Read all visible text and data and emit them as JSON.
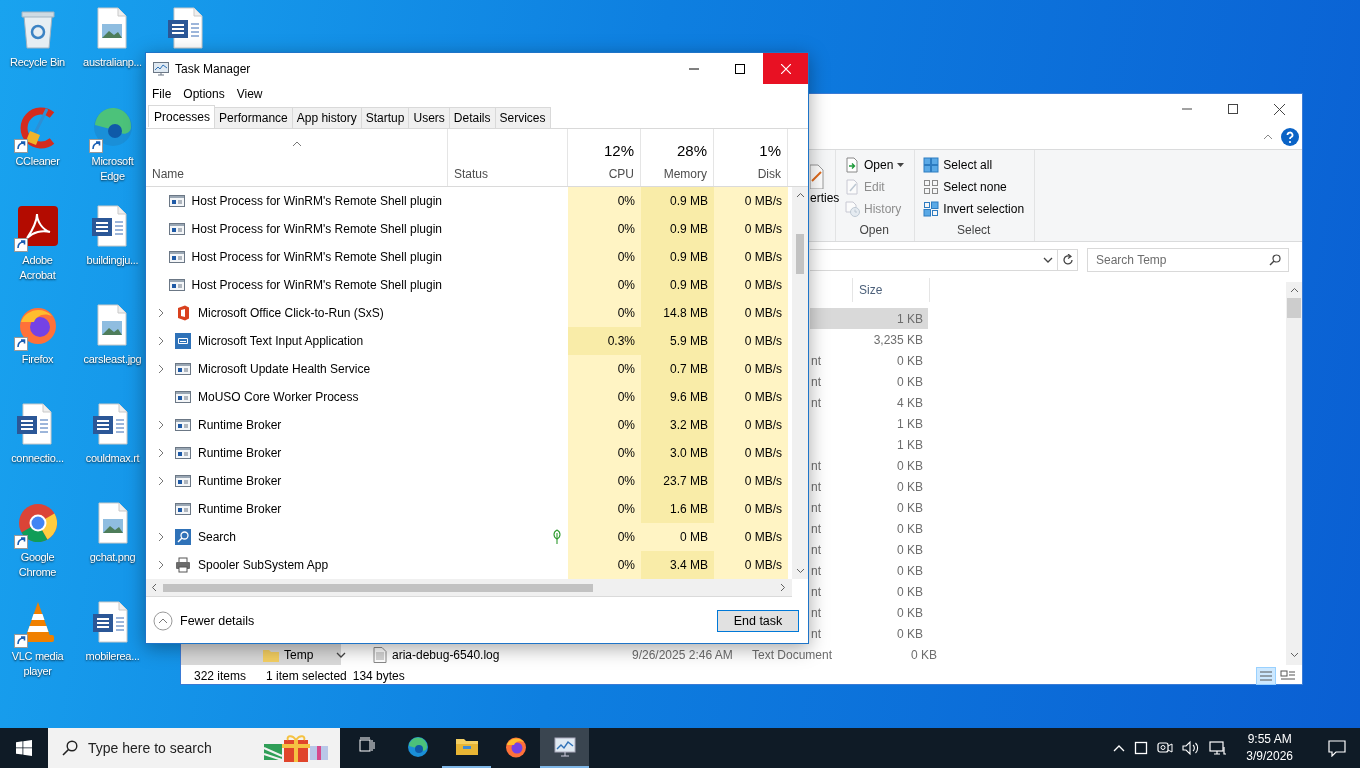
{
  "desktop": {
    "icons": [
      {
        "label": "Recycle Bin",
        "kind": "recycle",
        "shortcut": false
      },
      {
        "label": "CCleaner",
        "kind": "ccleaner",
        "shortcut": true
      },
      {
        "label": "Adobe Acrobat",
        "kind": "acrobat",
        "shortcut": true
      },
      {
        "label": "Firefox",
        "kind": "firefox",
        "shortcut": true
      },
      {
        "label": "connectio...",
        "kind": "word",
        "shortcut": false
      },
      {
        "label": "Google Chrome",
        "kind": "chrome",
        "shortcut": true
      },
      {
        "label": "VLC media player",
        "kind": "vlc",
        "shortcut": true
      },
      {
        "label": "australianp...",
        "kind": "image",
        "shortcut": false
      },
      {
        "label": "Microsoft Edge",
        "kind": "edge",
        "shortcut": true
      },
      {
        "label": "buildingju...",
        "kind": "word",
        "shortcut": false
      },
      {
        "label": "carsleast.jpg",
        "kind": "image",
        "shortcut": false
      },
      {
        "label": "couldmax.rt",
        "kind": "word",
        "shortcut": false
      },
      {
        "label": "gchat.png",
        "kind": "image",
        "shortcut": false
      },
      {
        "label": "mobilerea...",
        "kind": "word",
        "shortcut": false
      },
      {
        "kind": "word",
        "shortcut": false
      }
    ]
  },
  "explorer": {
    "cut_button": "erties",
    "ribbon_groups": [
      {
        "label": "Open",
        "items": [
          {
            "label": "Open",
            "kind": "open",
            "disabled": false,
            "dropdown": true
          },
          {
            "label": "Edit",
            "kind": "edit",
            "disabled": true,
            "dropdown": false
          },
          {
            "label": "History",
            "kind": "history",
            "disabled": true,
            "dropdown": false
          }
        ]
      },
      {
        "label": "Select",
        "items": [
          {
            "label": "Select all",
            "kind": "select-all",
            "disabled": false,
            "dropdown": false
          },
          {
            "label": "Select none",
            "kind": "select-none",
            "disabled": false,
            "dropdown": false
          },
          {
            "label": "Invert selection",
            "kind": "invert",
            "disabled": false,
            "dropdown": false
          }
        ]
      }
    ],
    "search": {
      "placeholder": "Search Temp"
    },
    "size_header": "Size",
    "rows": [
      {
        "size": "1 KB",
        "selected": true
      },
      {
        "size": "3,235 KB",
        "selected": false
      },
      {
        "type": "nt",
        "size": "0 KB",
        "selected": false
      },
      {
        "type": "nt",
        "size": "0 KB",
        "selected": false
      },
      {
        "type": "nt",
        "size": "4 KB",
        "selected": false
      },
      {
        "size": "1 KB",
        "selected": false
      },
      {
        "size": "1 KB",
        "selected": false
      },
      {
        "type": "nt",
        "size": "0 KB",
        "selected": false
      },
      {
        "type": "nt",
        "size": "0 KB",
        "selected": false
      },
      {
        "type": "nt",
        "size": "0 KB",
        "selected": false
      },
      {
        "type": "nt",
        "size": "0 KB",
        "selected": false
      },
      {
        "type": "nt",
        "size": "0 KB",
        "selected": false
      },
      {
        "type": "nt",
        "size": "0 KB",
        "selected": false
      },
      {
        "type": "nt",
        "size": "0 KB",
        "selected": false
      },
      {
        "type": "nt",
        "size": "0 KB",
        "selected": false
      },
      {
        "type": "nt",
        "size": "0 KB",
        "selected": false
      }
    ],
    "nav_item": {
      "label": "Temp",
      "selected": true
    },
    "last_row": {
      "name": "aria-debug-6540.log",
      "date": "9/26/2025 2:46 AM",
      "type": "Text Document",
      "size": "0 KB",
      "selected": false
    },
    "status_bar": [
      "322 items",
      "1 item selected",
      "134 bytes"
    ]
  },
  "task_manager": {
    "title": "Task Manager",
    "menu": [
      "File",
      "Options",
      "View"
    ],
    "tabs": [
      {
        "label": "Processes",
        "selected": true
      },
      {
        "label": "Performance",
        "selected": false
      },
      {
        "label": "App history",
        "selected": false
      },
      {
        "label": "Startup",
        "selected": false
      },
      {
        "label": "Users",
        "selected": false
      },
      {
        "label": "Details",
        "selected": false
      },
      {
        "label": "Services",
        "selected": false
      }
    ],
    "columns": [
      {
        "label": "Name"
      },
      {
        "label": "Status"
      },
      {
        "label": "CPU",
        "total": "12%"
      },
      {
        "label": "Memory",
        "total": "28%"
      },
      {
        "label": "Disk",
        "total": "1%"
      }
    ],
    "processes": [
      {
        "name": "Host Process for WinRM's Remote Shell plugin",
        "kind": "window",
        "expandable": false,
        "efficiency_mode": false,
        "cpu": "0%",
        "memory": "0.9 MB",
        "disk": "0 MB/s",
        "cpu_active": false,
        "mem_active": true
      },
      {
        "name": "Host Process for WinRM's Remote Shell plugin",
        "kind": "window",
        "expandable": false,
        "efficiency_mode": false,
        "cpu": "0%",
        "memory": "0.9 MB",
        "disk": "0 MB/s",
        "cpu_active": false,
        "mem_active": true
      },
      {
        "name": "Host Process for WinRM's Remote Shell plugin",
        "kind": "window",
        "expandable": false,
        "efficiency_mode": false,
        "cpu": "0%",
        "memory": "0.9 MB",
        "disk": "0 MB/s",
        "cpu_active": false,
        "mem_active": true
      },
      {
        "name": "Host Process for WinRM's Remote Shell plugin",
        "kind": "window",
        "expandable": false,
        "efficiency_mode": false,
        "cpu": "0%",
        "memory": "0.9 MB",
        "disk": "0 MB/s",
        "cpu_active": false,
        "mem_active": true
      },
      {
        "name": "Microsoft Office Click-to-Run (SxS)",
        "kind": "office",
        "expandable": true,
        "efficiency_mode": false,
        "cpu": "0%",
        "memory": "14.8 MB",
        "disk": "0 MB/s",
        "cpu_active": false,
        "mem_active": true
      },
      {
        "name": "Microsoft Text Input Application",
        "kind": "keyboard",
        "expandable": true,
        "efficiency_mode": false,
        "cpu": "0.3%",
        "memory": "5.9 MB",
        "disk": "0 MB/s",
        "cpu_active": true,
        "mem_active": true
      },
      {
        "name": "Microsoft Update Health Service",
        "kind": "window",
        "expandable": true,
        "efficiency_mode": false,
        "cpu": "0%",
        "memory": "0.7 MB",
        "disk": "0 MB/s",
        "cpu_active": false,
        "mem_active": true
      },
      {
        "name": "MoUSO Core Worker Process",
        "kind": "window",
        "expandable": false,
        "efficiency_mode": false,
        "cpu": "0%",
        "memory": "9.6 MB",
        "disk": "0 MB/s",
        "cpu_active": false,
        "mem_active": true
      },
      {
        "name": "Runtime Broker",
        "kind": "window",
        "expandable": true,
        "efficiency_mode": false,
        "cpu": "0%",
        "memory": "3.2 MB",
        "disk": "0 MB/s",
        "cpu_active": false,
        "mem_active": true
      },
      {
        "name": "Runtime Broker",
        "kind": "window",
        "expandable": true,
        "efficiency_mode": false,
        "cpu": "0%",
        "memory": "3.0 MB",
        "disk": "0 MB/s",
        "cpu_active": false,
        "mem_active": true
      },
      {
        "name": "Runtime Broker",
        "kind": "window",
        "expandable": true,
        "efficiency_mode": false,
        "cpu": "0%",
        "memory": "23.7 MB",
        "disk": "0 MB/s",
        "cpu_active": false,
        "mem_active": true
      },
      {
        "name": "Runtime Broker",
        "kind": "window",
        "expandable": false,
        "efficiency_mode": false,
        "cpu": "0%",
        "memory": "1.6 MB",
        "disk": "0 MB/s",
        "cpu_active": false,
        "mem_active": true
      },
      {
        "name": "Search",
        "kind": "search",
        "expandable": true,
        "efficiency_mode": true,
        "cpu": "0%",
        "memory": "0 MB",
        "disk": "0 MB/s",
        "cpu_active": false,
        "mem_active": false
      },
      {
        "name": "Spooler SubSystem App",
        "kind": "printer",
        "expandable": true,
        "efficiency_mode": false,
        "cpu": "0%",
        "memory": "3.4 MB",
        "disk": "0 MB/s",
        "cpu_active": false,
        "mem_active": true
      }
    ],
    "details_toggle": "Fewer details",
    "end_button": "End task"
  },
  "taskbar": {
    "search": {
      "placeholder": "Type here to search"
    },
    "apps": [
      {
        "kind": "taskview",
        "running": false,
        "active": false
      },
      {
        "kind": "edge",
        "running": false,
        "active": false
      },
      {
        "kind": "explorer",
        "running": true,
        "active": false
      },
      {
        "kind": "firefox",
        "running": false,
        "active": false
      },
      {
        "kind": "taskmgr",
        "running": true,
        "active": true
      }
    ],
    "clock": {
      "time": "9:55 AM",
      "date": "3/9/2026"
    }
  }
}
